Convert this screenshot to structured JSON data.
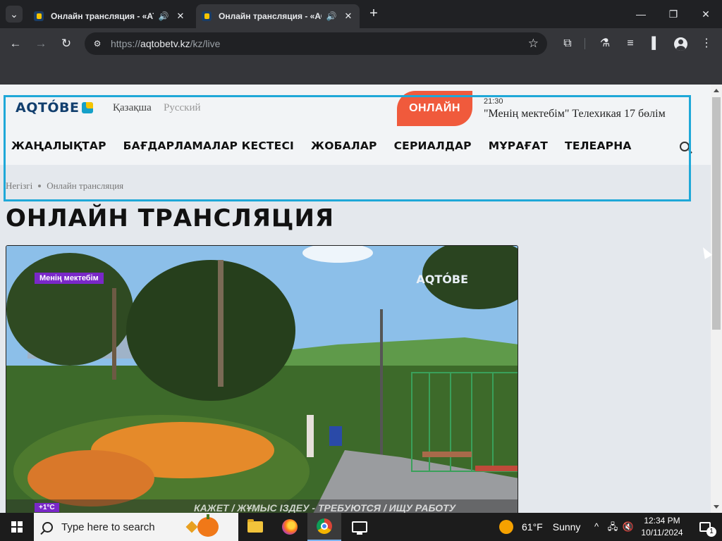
{
  "browser": {
    "tabs": [
      {
        "title": "Онлайн трансляция - «АТ",
        "active": false
      },
      {
        "title": "Онлайн трансляция - «АС",
        "active": true
      }
    ],
    "url": {
      "scheme": "https://",
      "host": "aqtobetv.kz",
      "path": "/kz/live"
    },
    "icons": {
      "tab_list": "chevron-down-icon",
      "audio": "speaker-icon",
      "close": "close-icon",
      "new_tab": "plus-icon",
      "back": "arrow-left-icon",
      "forward": "arrow-right-icon",
      "reload": "reload-icon",
      "site_info": "tune-icon",
      "bookmark": "star-icon",
      "extensions": "puzzle-icon",
      "labs": "flask-icon",
      "media": "media-control-icon",
      "side_panel": "side-panel-icon",
      "profile": "profile-icon",
      "menu": "kebab-menu-icon"
    },
    "glyphs": {
      "tab_list": "⌄",
      "audio": "🔊",
      "close": "✕",
      "new_tab": "+",
      "minimize": "—",
      "restore": "❐",
      "window_close": "✕",
      "back": "←",
      "forward": "→",
      "reload": "↻",
      "site_info": "⚙",
      "bookmark": "☆",
      "extensions": "⧉",
      "labs": "⚗",
      "media": "≡",
      "side_panel": "▌",
      "menu": "⋮"
    }
  },
  "site": {
    "logo_text": "AQTÓBE",
    "languages": {
      "kazakh": "Қазақша",
      "russian": "Русский"
    },
    "live_button": "ОНЛАЙН",
    "now_playing": {
      "time": "21:30",
      "title": "\"Менің мектебім\" Телехикая 17 бөлім"
    },
    "nav": [
      "ЖАҢАЛЫҚТАР",
      "БАҒДАРЛАМАЛАР КЕСТЕСІ",
      "ЖОБАЛАР",
      "СЕРИАЛДАР",
      "МҰРАҒАТ",
      "ТЕЛЕАРНА"
    ],
    "breadcrumb": {
      "home": "Негізгі",
      "current": "Онлайн трансляция"
    },
    "page_title": "ОНЛАЙН ТРАНСЛЯЦИЯ",
    "player": {
      "show_badge": "Менің мектебім",
      "watermark": "AQTÓBE",
      "temperature": "+1°C",
      "ticker": "КАЖЕТ / ЖҰМЫС ІЗДЕУ - ТРЕБУЮТСЯ / ИЩУ РАБОТУ"
    },
    "colors": {
      "brand_blue": "#123f6e",
      "live_orange": "#f05a3c",
      "accent_yellow": "#f5c400",
      "highlight_cyan": "#1fa8d8"
    }
  },
  "taskbar": {
    "search_placeholder": "Type here to search",
    "weather": {
      "temp": "61°F",
      "condition": "Sunny"
    },
    "clock": {
      "time": "12:34 PM",
      "date": "10/11/2024"
    },
    "notification_count": "1",
    "tray_glyphs": {
      "chevron": "^",
      "network": "🖧",
      "volume": "🔇"
    }
  }
}
